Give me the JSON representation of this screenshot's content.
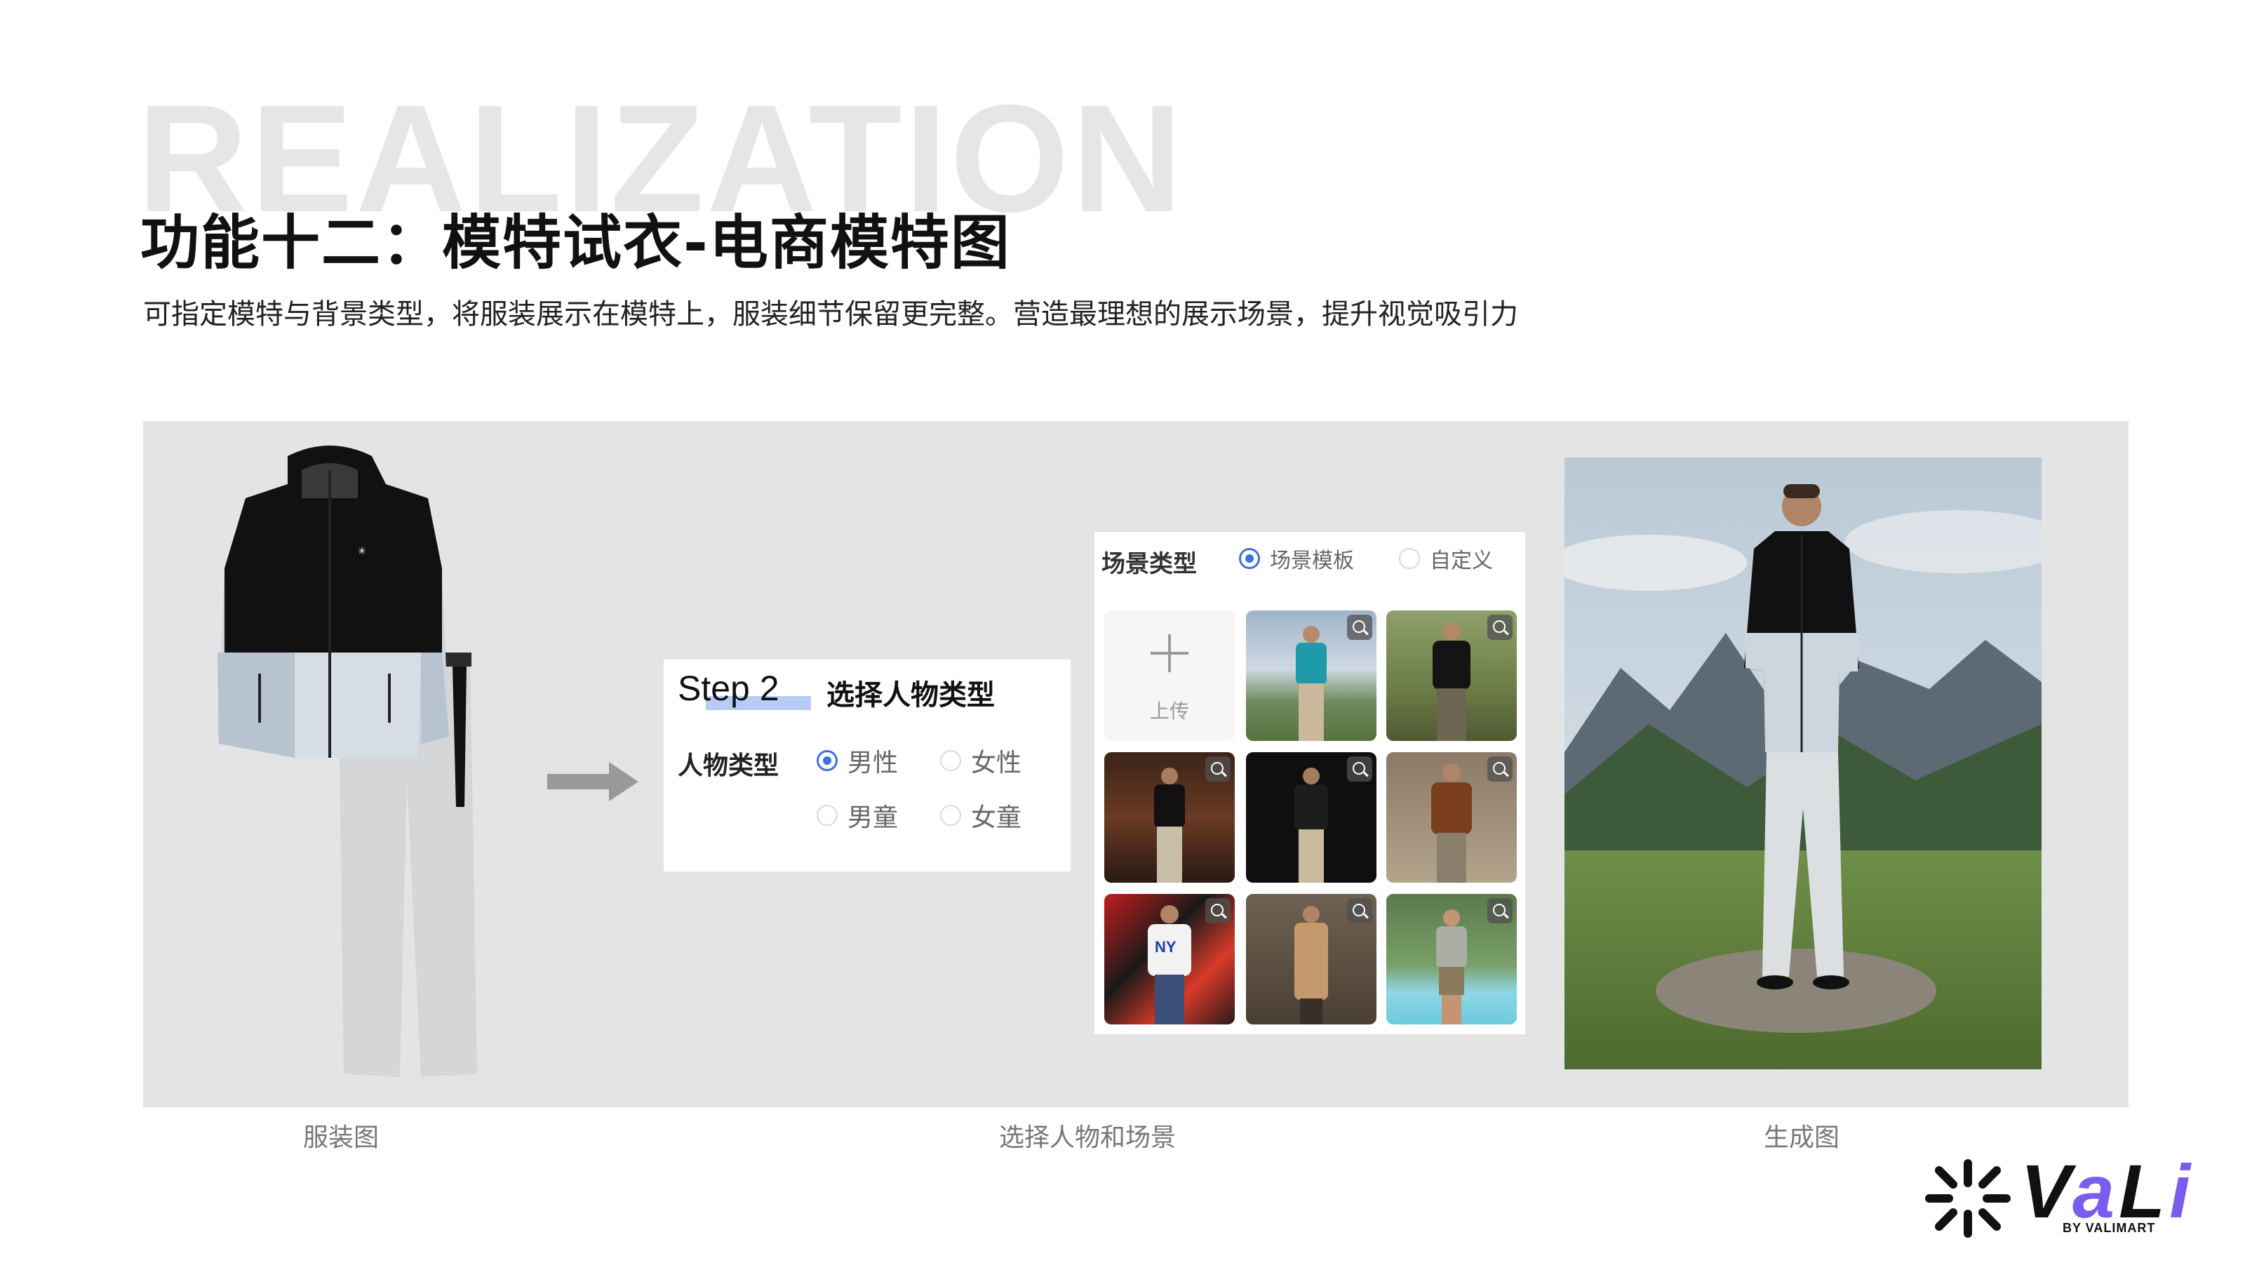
{
  "header": {
    "bg_word": "REALIZATION",
    "title": "功能十二：模特试衣-电商模特图",
    "subtitle": "可指定模特与背景类型，将服装展示在模特上，服装细节保留更完整。营造最理想的展示场景，提升视觉吸引力"
  },
  "step": {
    "step_text": "Step 2",
    "label": "选择人物类型",
    "field_label": "人物类型",
    "options": [
      "男性",
      "女性",
      "男童",
      "女童"
    ],
    "selected": "男性"
  },
  "scene": {
    "label": "场景类型",
    "options": [
      "场景模板",
      "自定义"
    ],
    "selected": "场景模板",
    "upload_label": "上传"
  },
  "captions": {
    "garment": "服装图",
    "select": "选择人物和场景",
    "generated": "生成图"
  },
  "logo": {
    "word": "VaLi",
    "sub": "BY VALIMART"
  },
  "colors": {
    "accent": "#3f6fe0",
    "panel_bg": "#e4e4e4",
    "logo_purple": "#7b5cf0"
  }
}
